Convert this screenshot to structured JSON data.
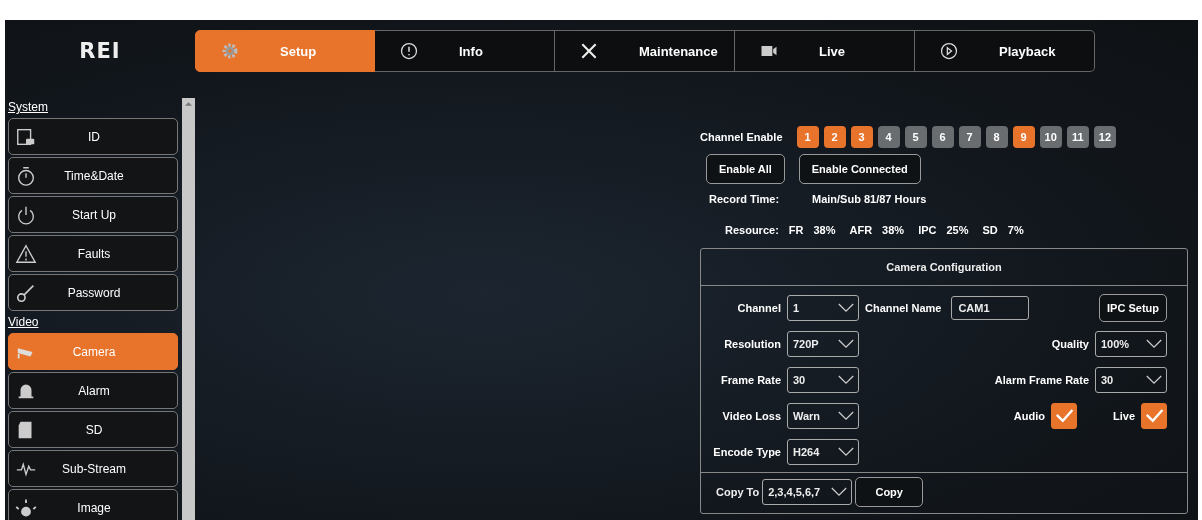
{
  "logo": "REI",
  "nav_tabs": [
    {
      "label": "Setup",
      "selected": true
    },
    {
      "label": "Info",
      "selected": false
    },
    {
      "label": "Maintenance",
      "selected": false
    },
    {
      "label": "Live",
      "selected": false
    },
    {
      "label": "Playback",
      "selected": false
    }
  ],
  "sidebar": {
    "sections": [
      {
        "title": "System",
        "items": [
          {
            "label": "ID",
            "selected": false
          },
          {
            "label": "Time&Date",
            "selected": false
          },
          {
            "label": "Start Up",
            "selected": false
          },
          {
            "label": "Faults",
            "selected": false
          },
          {
            "label": "Password",
            "selected": false
          }
        ]
      },
      {
        "title": "Video",
        "items": [
          {
            "label": "Camera",
            "selected": true
          },
          {
            "label": "Alarm",
            "selected": false
          },
          {
            "label": "SD",
            "selected": false
          },
          {
            "label": "Sub-Stream",
            "selected": false
          },
          {
            "label": "Image",
            "selected": false
          }
        ]
      }
    ]
  },
  "channel_enable": {
    "label": "Channel Enable",
    "channels": [
      {
        "label": "1",
        "on": true
      },
      {
        "label": "2",
        "on": true
      },
      {
        "label": "3",
        "on": true
      },
      {
        "label": "4",
        "on": false
      },
      {
        "label": "5",
        "on": false
      },
      {
        "label": "6",
        "on": false
      },
      {
        "label": "7",
        "on": false
      },
      {
        "label": "8",
        "on": false
      },
      {
        "label": "9",
        "on": true
      },
      {
        "label": "10",
        "on": false
      },
      {
        "label": "11",
        "on": false
      },
      {
        "label": "12",
        "on": false
      }
    ]
  },
  "buttons": [
    "Enable All",
    "Enable Connected"
  ],
  "record_time": {
    "label": "Record Time:",
    "value": "Main/Sub 81/87 Hours"
  },
  "resource": {
    "label": "Resource:",
    "items": [
      {
        "name": "FR",
        "value": "38%"
      },
      {
        "name": "AFR",
        "value": "38%"
      },
      {
        "name": "IPC",
        "value": "25%"
      },
      {
        "name": "SD",
        "value": "7%"
      }
    ]
  },
  "camera_config": {
    "title": "Camera Configuration",
    "rows": [
      {
        "left": [
          {
            "kind": "select",
            "label": "Channel",
            "value": "1"
          },
          {
            "kind": "text",
            "label": "Channel Name",
            "value": "CAM1"
          }
        ],
        "right": [
          {
            "kind": "button",
            "label": "IPC Setup"
          }
        ]
      },
      {
        "left": [
          {
            "kind": "select",
            "label": "Resolution",
            "value": "720P"
          }
        ],
        "right": [
          {
            "kind": "select",
            "label": "Quality",
            "value": "100%"
          }
        ]
      },
      {
        "left": [
          {
            "kind": "select",
            "label": "Frame Rate",
            "value": "30"
          }
        ],
        "right": [
          {
            "kind": "select",
            "label": "Alarm Frame Rate",
            "value": "30"
          }
        ]
      },
      {
        "left": [
          {
            "kind": "select",
            "label": "Video Loss",
            "value": "Warn"
          }
        ],
        "right": [
          {
            "kind": "checkbox",
            "label": "Audio",
            "checked": true
          },
          {
            "kind": "checkbox",
            "label": "Live",
            "checked": true
          }
        ]
      },
      {
        "left": [
          {
            "kind": "select",
            "label": "Encode Type",
            "value": "H264"
          }
        ],
        "right": []
      }
    ],
    "copy_to": {
      "label": "Copy To",
      "value": "2,3,4,5,6,7"
    },
    "copy_button": "Copy"
  }
}
